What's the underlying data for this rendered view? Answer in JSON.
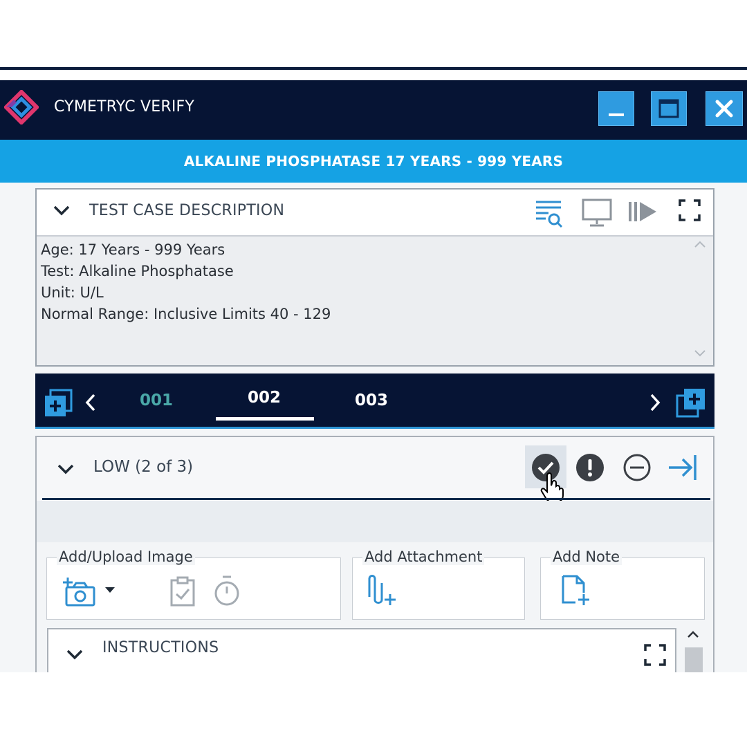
{
  "app": {
    "title": "CYMETRYC VERIFY",
    "banner": "ALKALINE PHOSPHATASE 17 YEARS - 999 YEARS",
    "colors": {
      "titlebar": "#061434",
      "banner": "#15a2e4",
      "window_button": "#2f9be0",
      "tab_inactive_left": "#4aa8a8"
    }
  },
  "window_controls": {
    "minimize_icon": "minimize-icon",
    "maximize_icon": "maximize-icon",
    "close_icon": "close-icon"
  },
  "test_case": {
    "header": "TEST CASE DESCRIPTION",
    "icons": [
      "filter-search-icon",
      "monitor-icon",
      "play-steps-icon",
      "expand-icon"
    ],
    "lines": [
      "Age: 17 Years - 999 Years",
      "Test: Alkaline Phosphatase",
      "Unit: U/L",
      "Normal Range: Inclusive Limits 40 - 129"
    ]
  },
  "tabs": {
    "items": [
      "001",
      "002",
      "003"
    ],
    "active": "002"
  },
  "result": {
    "title": "LOW (2 of 3)",
    "icons": [
      "check-circle-icon",
      "exclamation-circle-icon",
      "minus-circle-icon",
      "arrow-to-right-icon"
    ],
    "groups": {
      "image_label": "Add/Upload Image",
      "attachment_label": "Add Attachment",
      "note_label": "Add Note"
    }
  },
  "instructions": {
    "title": "INSTRUCTIONS"
  }
}
